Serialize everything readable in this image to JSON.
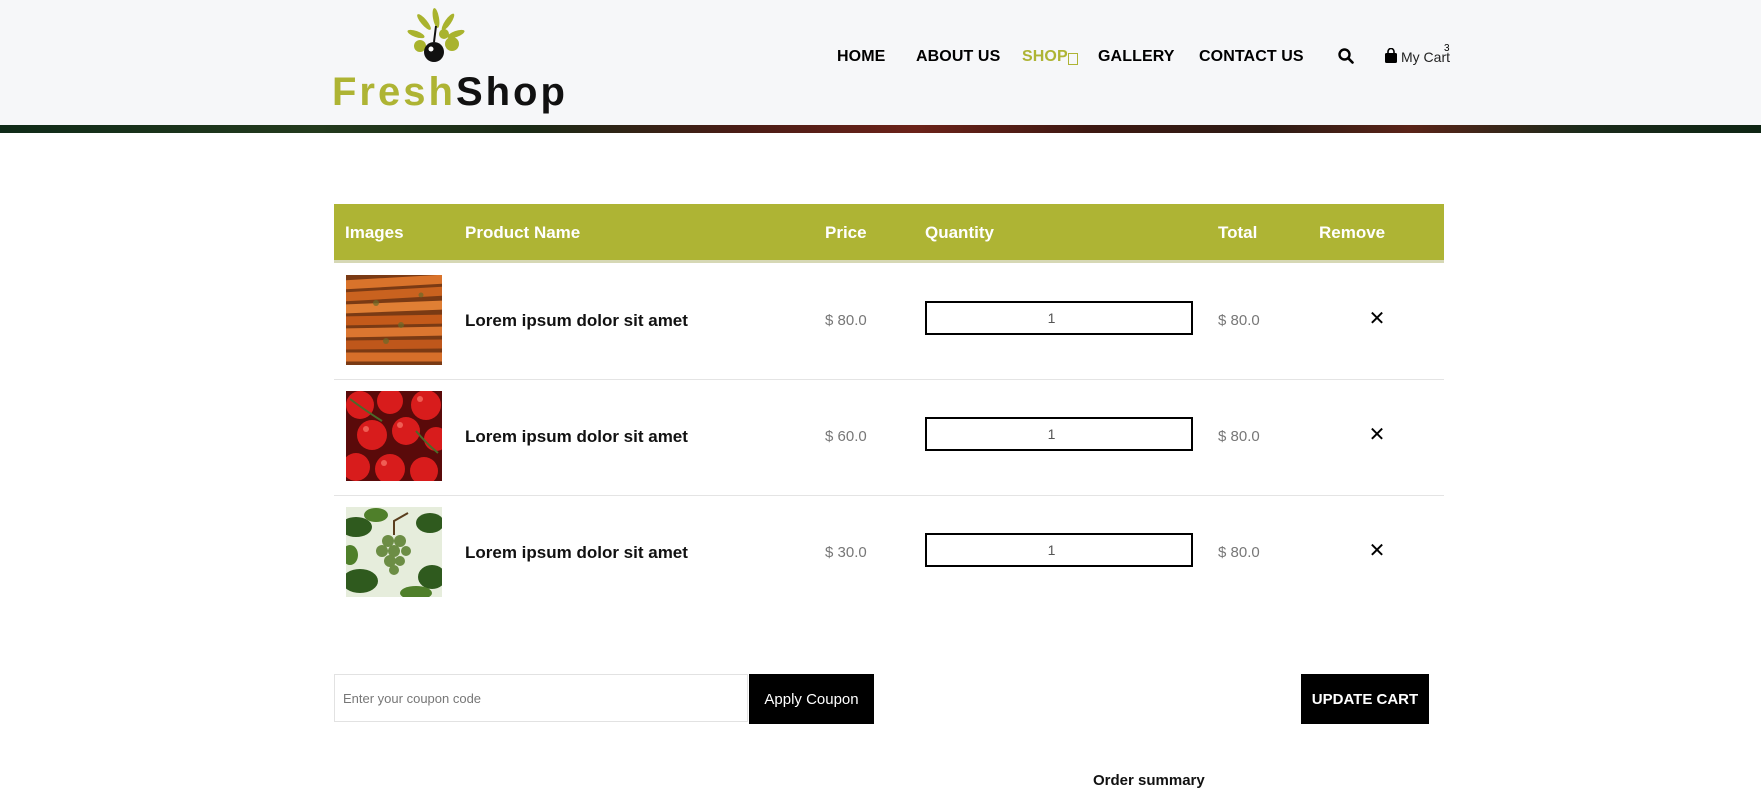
{
  "brand": {
    "name_part1": "Fresh",
    "name_part2": "Shop",
    "color_primary": "#aeb434"
  },
  "nav": {
    "items": [
      {
        "label": "HOME"
      },
      {
        "label": "ABOUT US"
      },
      {
        "label": "SHOP",
        "active": true
      },
      {
        "label": "GALLERY"
      },
      {
        "label": "CONTACT US"
      }
    ],
    "search_icon": "search-icon",
    "cart": {
      "label": "My Cart",
      "count": "3",
      "icon": "shopping-bag-icon"
    }
  },
  "cart_table": {
    "headers": {
      "images": "Images",
      "product_name": "Product Name",
      "price": "Price",
      "quantity": "Quantity",
      "total": "Total",
      "remove": "Remove"
    },
    "rows": [
      {
        "name": "Lorem ipsum dolor sit amet",
        "price": "$ 80.0",
        "quantity": "1",
        "total": "$ 80.0",
        "image": "carrots",
        "remove_icon": "close-icon"
      },
      {
        "name": "Lorem ipsum dolor sit amet",
        "price": "$ 60.0",
        "quantity": "1",
        "total": "$ 80.0",
        "image": "tomatoes",
        "remove_icon": "close-icon"
      },
      {
        "name": "Lorem ipsum dolor sit amet",
        "price": "$ 30.0",
        "quantity": "1",
        "total": "$ 80.0",
        "image": "grapes",
        "remove_icon": "close-icon"
      }
    ]
  },
  "coupon": {
    "placeholder": "Enter your coupon code",
    "value": "",
    "apply_label": "Apply Coupon"
  },
  "update_cart_label": "UPDATE CART",
  "order_summary": {
    "title": "Order summary"
  }
}
